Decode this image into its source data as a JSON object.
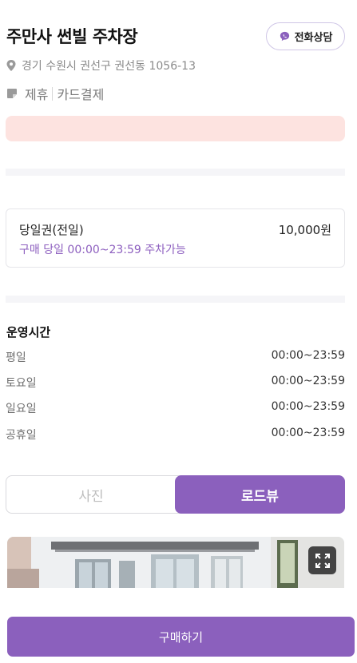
{
  "header": {
    "title": "주만사 썬빌 주차장",
    "call_label": "전화상담",
    "address": "경기 수원시 권선구 권선동 1056-13",
    "tags": [
      "제휴",
      "카드결제"
    ]
  },
  "ticket": {
    "name": "당일권(전일)",
    "price": "10,000원",
    "description": "구매 당일 00:00~23:59 주차가능"
  },
  "hours": {
    "title": "운영시간",
    "rows": [
      {
        "day": "평일",
        "time": "00:00~23:59"
      },
      {
        "day": "토요일",
        "time": "00:00~23:59"
      },
      {
        "day": "일요일",
        "time": "00:00~23:59"
      },
      {
        "day": "공휴일",
        "time": "00:00~23:59"
      }
    ]
  },
  "view_toggle": {
    "photo_label": "사진",
    "roadview_label": "로드뷰",
    "selected": "로드뷰"
  },
  "buy_button": "구매하기",
  "colors": {
    "accent": "#8b60bd",
    "notice_bg": "#fde3e0"
  },
  "icons": [
    "phone-chat-icon",
    "location-pin-icon",
    "tag-icon",
    "expand-icon"
  ]
}
